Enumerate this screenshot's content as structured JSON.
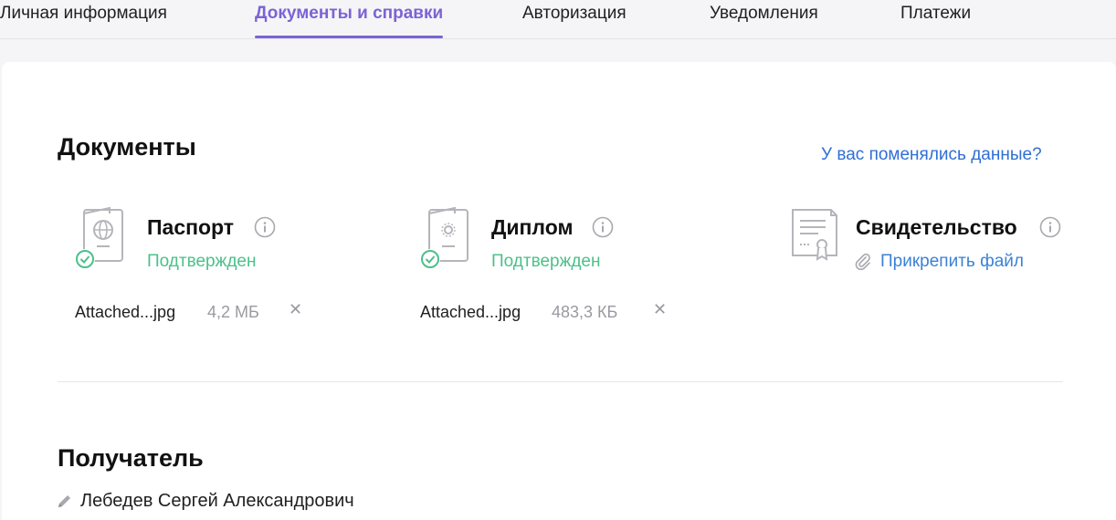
{
  "tabs": [
    {
      "label": "Личная информация",
      "active": false
    },
    {
      "label": "Документы и справки",
      "active": true
    },
    {
      "label": "Авторизация",
      "active": false
    },
    {
      "label": "Уведомления",
      "active": false
    },
    {
      "label": "Платежи",
      "active": false
    }
  ],
  "documents": {
    "title": "Документы",
    "changed_link": "У вас поменялись данные?",
    "items": [
      {
        "name": "Паспорт",
        "status": "Подтвержден",
        "icon": "passport-icon",
        "file": {
          "name": "Attached...jpg",
          "size": "4,2 МБ"
        }
      },
      {
        "name": "Диплом",
        "status": "Подтвержден",
        "icon": "diploma-icon",
        "file": {
          "name": "Attached...jpg",
          "size": "483,3 КБ"
        }
      },
      {
        "name": "Свидетельство",
        "attach_label": "Прикрепить файл",
        "icon": "certificate-icon"
      }
    ]
  },
  "recipient": {
    "title": "Получатель",
    "name": "Лебедев Сергей Александрович"
  },
  "colors": {
    "accent": "#7b63d6",
    "link": "#2f6fd6",
    "success": "#4cc08a",
    "muted": "#9a9aa0"
  }
}
